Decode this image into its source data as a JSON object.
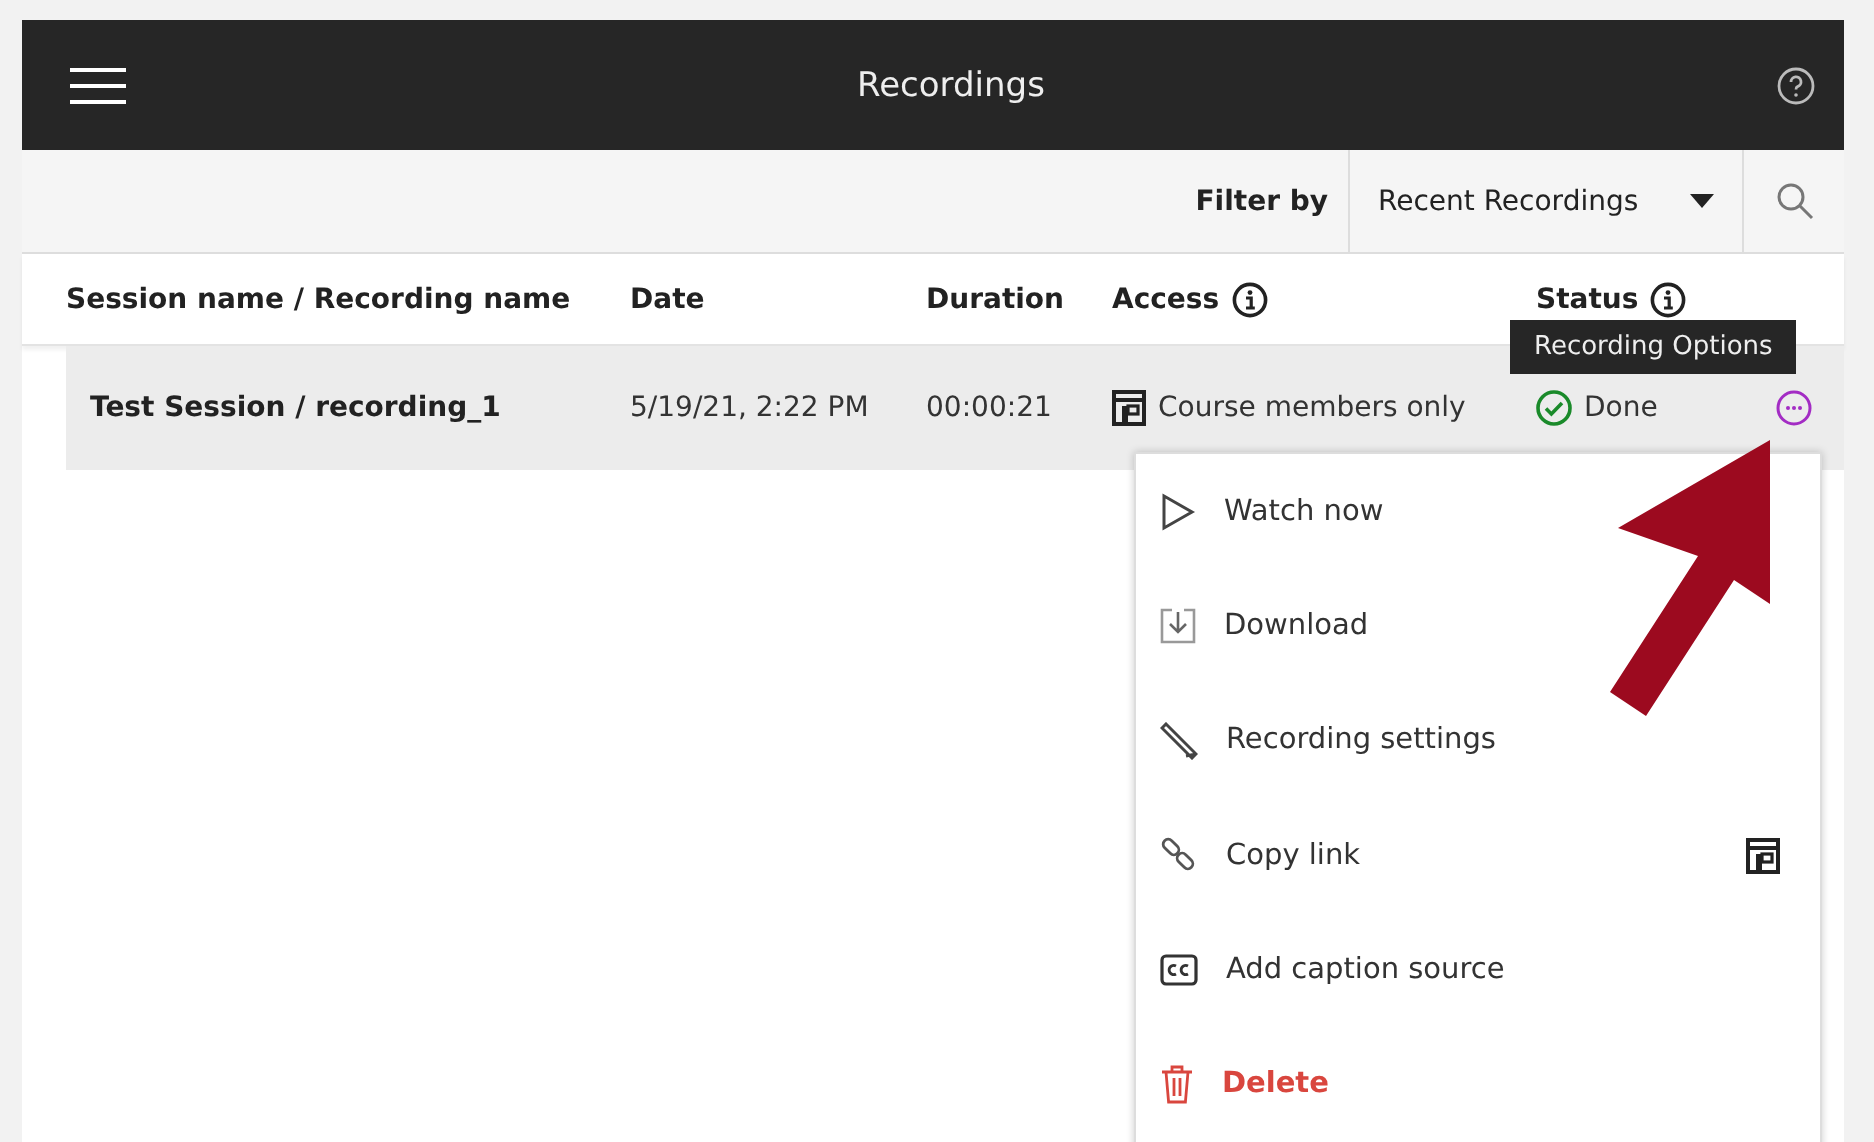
{
  "window": {
    "title": "Recordings"
  },
  "filter": {
    "label": "Filter by",
    "value": "Recent Recordings"
  },
  "table": {
    "columns": [
      {
        "label": "Session name / Recording name",
        "info": false
      },
      {
        "label": "Date",
        "info": false
      },
      {
        "label": "Duration",
        "info": false
      },
      {
        "label": "Access",
        "info": true
      },
      {
        "label": "Status",
        "info": true
      }
    ],
    "rows": [
      {
        "name": "Test Session / recording_1",
        "date": "5/19/21, 2:22 PM",
        "duration": "00:00:21",
        "access": "Course members only",
        "status": "Done",
        "selected": true
      }
    ]
  },
  "tooltip": "Recording Options",
  "menu": [
    {
      "label": "Watch now",
      "kind": "normal",
      "restricted": false
    },
    {
      "label": "Download",
      "kind": "normal",
      "restricted": false
    },
    {
      "label": "Recording settings",
      "kind": "normal",
      "restricted": false
    },
    {
      "label": "Copy link",
      "kind": "normal",
      "restricted": true
    },
    {
      "label": "Add caption source",
      "kind": "normal",
      "restricted": false
    },
    {
      "label": "Delete",
      "kind": "danger",
      "restricted": false
    }
  ]
}
